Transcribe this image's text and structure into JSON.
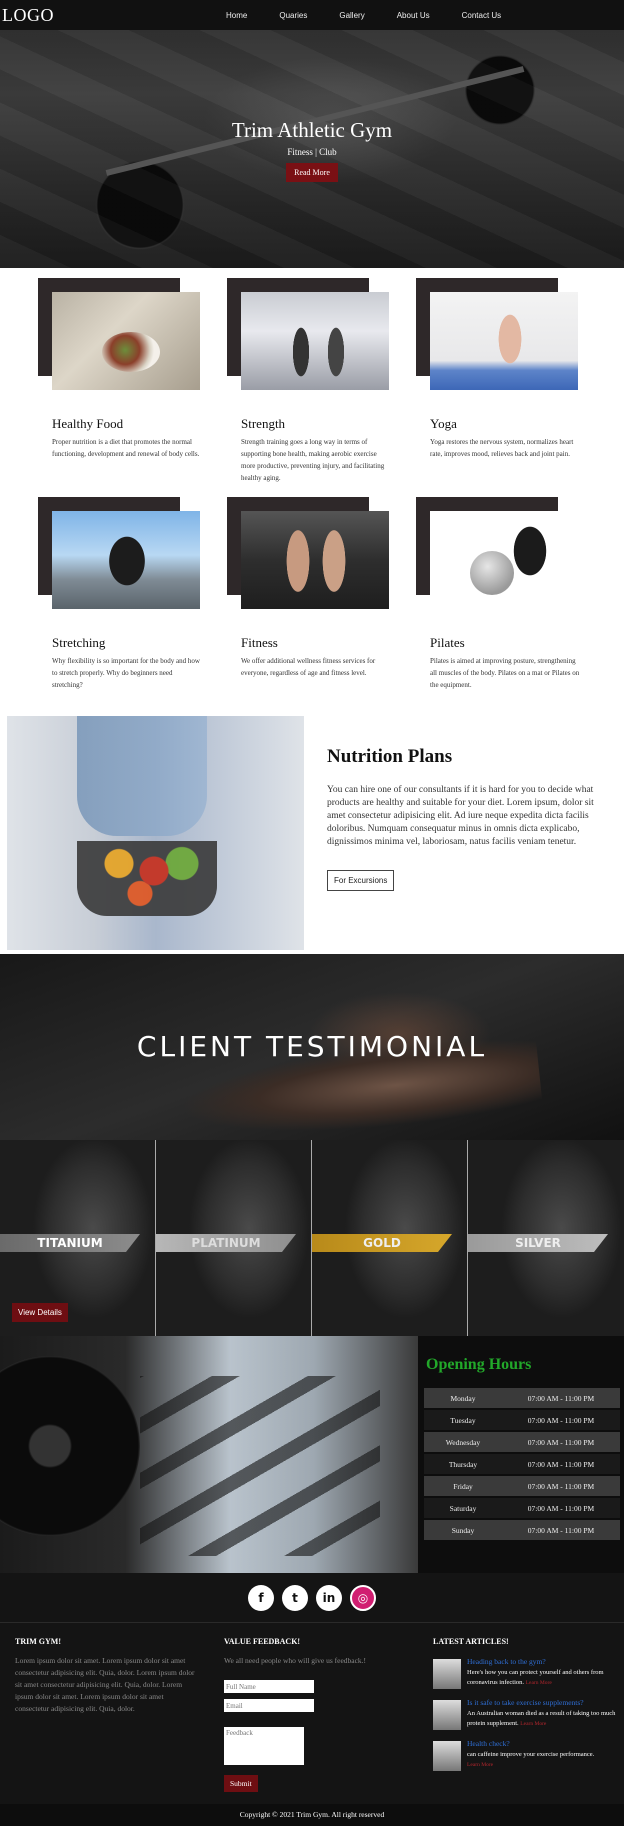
{
  "nav": {
    "logo": "LOGO",
    "links": [
      "Home",
      "Quaries",
      "Gallery",
      "About Us",
      "Contact Us"
    ]
  },
  "hero": {
    "title": "Trim Athletic Gym",
    "subtitle": "Fitness | Club",
    "button": "Read More"
  },
  "services": [
    {
      "title": "Healthy Food",
      "text": "Proper nutrition is a diet that promotes the normal functioning, development and renewal of body cells."
    },
    {
      "title": "Strength",
      "text": "Strength training goes a long way in terms of supporting bone health, making aerobic exercise more productive, preventing injury, and facilitating healthy aging."
    },
    {
      "title": "Yoga",
      "text": "Yoga restores the nervous system, normalizes heart rate, improves mood, relieves back and joint pain."
    },
    {
      "title": "Stretching",
      "text": "Why flexibility is so important for the body and how to stretch properly. Why do beginners need stretching?"
    },
    {
      "title": "Fitness",
      "text": "We offer additional wellness fitness services for everyone, regardless of age and fitness level."
    },
    {
      "title": "Pilates",
      "text": "Pilates is aimed at improving posture, strengthening all muscles of the body. Pilates on a mat or Pilates on the equipment."
    }
  ],
  "nutrition": {
    "title": "Nutrition Plans",
    "text": "You can hire one of our consultants if it is hard for you to decide what products are healthy and suitable for your diet. Lorem ipsum, dolor sit amet consectetur adipisicing elit. Ad iure neque expedita dicta facilis doloribus. Numquam consequatur minus in omnis dicta explicabo, dignissimos minima vel, laboriosam, natus facilis veniam tenetur.",
    "button": "For Excursions"
  },
  "testimonial": {
    "title": "CLIENT TESTIMONIAL"
  },
  "plans": {
    "items": [
      "TITANIUM",
      "PLATINUM",
      "GOLD",
      "SILVER"
    ],
    "button": "View Details"
  },
  "hours": {
    "title": "Opening Hours",
    "rows": [
      {
        "day": "Monday",
        "time": "07:00 AM - 11:00 PM"
      },
      {
        "day": "Tuesday",
        "time": "07:00 AM - 11:00 PM"
      },
      {
        "day": "Wednesday",
        "time": "07:00 AM - 11:00 PM"
      },
      {
        "day": "Thursday",
        "time": "07:00 AM - 11:00 PM"
      },
      {
        "day": "Friday",
        "time": "07:00 AM - 11:00 PM"
      },
      {
        "day": "Saturday",
        "time": "07:00 AM - 11:00 PM"
      },
      {
        "day": "Sunday",
        "time": "07:00 AM - 11:00 PM"
      }
    ]
  },
  "social": {
    "facebook": "f",
    "twitter": "t",
    "linkedin": "in",
    "instagram": "◎"
  },
  "footer": {
    "about_head": "TRIM GYM!",
    "about_text": "Lorem ipsum dolor sit amet. Lorem ipsum dolor sit amet consectetur adipisicing elit. Quia, dolor. Lorem ipsum dolor sit amet consectetur adipisicing elit. Quia, dolor. Lorem ipsum dolor sit amet. Lorem ipsum dolor sit amet consectetur adipisicing elit. Quia, dolor.",
    "feedback_head": "VALUE FEEDBACK!",
    "feedback_text": "We all need people who will give us feedback.!",
    "name_placeholder": "Full Name",
    "email_placeholder": "Email",
    "feedback_placeholder": "Feedback",
    "submit": "Submit",
    "articles_head": "LATEST ARTICLES!",
    "read_more": "Learn More",
    "articles": [
      {
        "title": "Heading back to the gym?",
        "text": "Here's how you can protect yourself and others from coronavirus infection."
      },
      {
        "title": "Is it safe to take exercise supplements?",
        "text": "An Australian woman died as a result of taking too much protein supplement."
      },
      {
        "title": "Health check?",
        "text": "can caffeine improve your exercise performance."
      }
    ],
    "copyright": "Copyright © 2021 Trim Gym. All right reserved"
  }
}
